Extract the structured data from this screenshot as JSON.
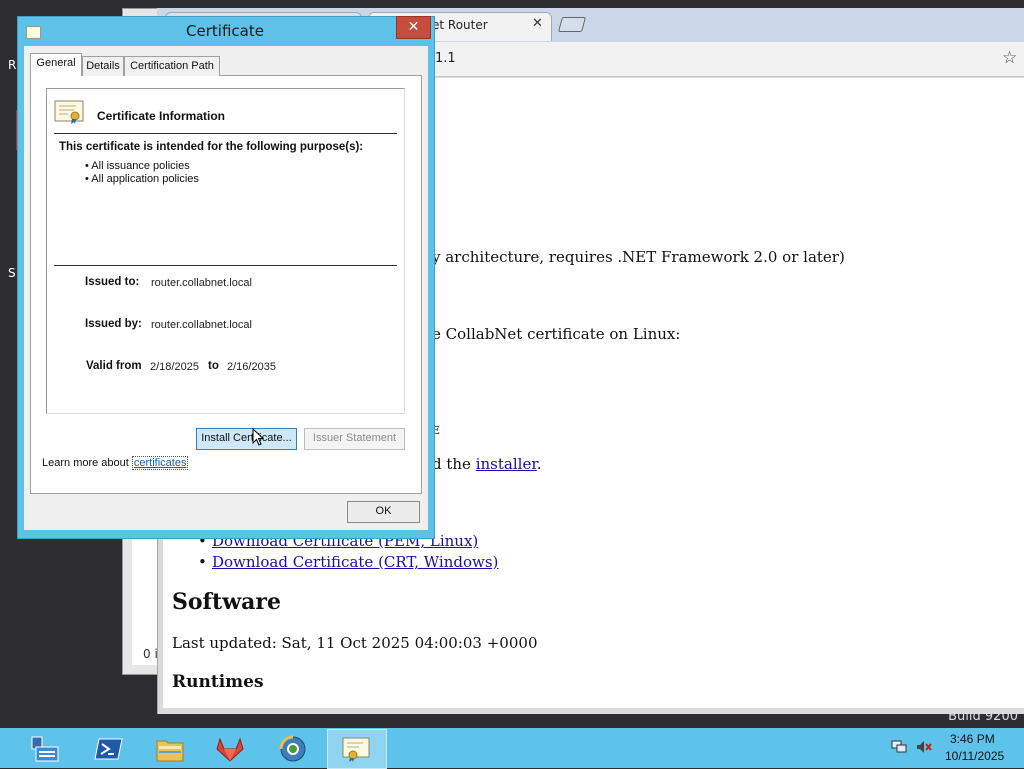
{
  "desktop": {
    "fragments": [
      "R",
      "S"
    ],
    "build_text": "Build 9200"
  },
  "background_window": {
    "status_fragment": "0 i"
  },
  "browser": {
    "tab_title": "et Router",
    "tab_close": "✕",
    "url_fragment": "1.1",
    "star_icon": "☆",
    "page": {
      "arch_text": "y architecture, requires .NET Framework 2.0 or later)",
      "linux_text": "e CollabNet certificate on Linux:",
      "e_fragment": "E",
      "install_prefix": "d the ",
      "install_link": "installer",
      "install_suffix": ".",
      "downloads": [
        "Download Certificate (PEM, Linux)",
        "Download Certificate (CRT, Windows)"
      ],
      "software_heading": "Software",
      "last_updated": "Last updated: Sat, 11 Oct 2025 04:00:03 +0000",
      "runtimes_heading": "Runtimes"
    }
  },
  "dialog": {
    "title": "Certificate",
    "close_label": "✕",
    "tabs": [
      "General",
      "Details",
      "Certification Path"
    ],
    "active_tab": "General",
    "info_heading": "Certificate Information",
    "purpose_heading": "This certificate is intended for the following purpose(s):",
    "purposes": [
      "• All issuance policies",
      "• All application policies"
    ],
    "issued_to_label": "Issued to:",
    "issued_to": "router.collabnet.local",
    "issued_by_label": "Issued by:",
    "issued_by": "router.collabnet.local",
    "valid_from_label": "Valid from",
    "valid_from": "2/18/2025",
    "to_label": "to",
    "valid_to": "2/16/2035",
    "install_button": "Install Certificate...",
    "issuer_button": "Issuer Statement",
    "learn_more_prefix": "Learn more about ",
    "learn_more_link": "certificates",
    "ok_button": "OK"
  },
  "taskbar": {
    "items": [
      "server-manager-icon",
      "powershell-icon",
      "file-explorer-icon",
      "gitlab-icon",
      "browser-icon",
      "certificate-icon"
    ],
    "clock_time": "3:46 PM",
    "clock_date": "10/11/2025"
  }
}
